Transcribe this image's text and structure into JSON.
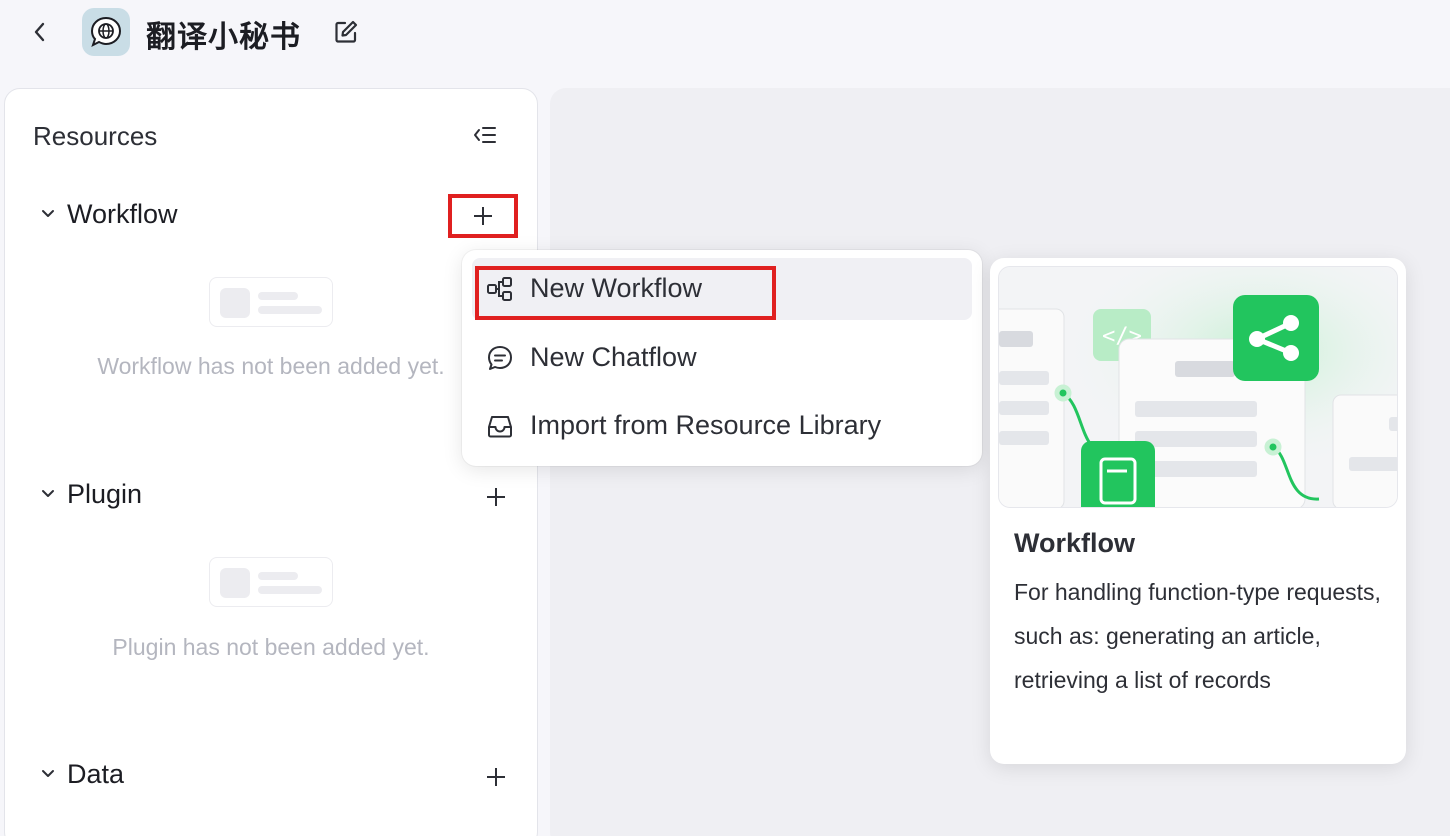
{
  "header": {
    "app_title": "翻译小秘书",
    "back_icon": "chevron-left-icon",
    "edit_icon": "edit-icon",
    "avatar_icon": "globe-chat-icon"
  },
  "sidebar": {
    "title": "Resources",
    "collapse_icon": "collapse-list-icon",
    "sections": [
      {
        "label": "Workflow",
        "empty_text": "Workflow has not been added yet."
      },
      {
        "label": "Plugin",
        "empty_text": "Plugin has not been added yet."
      },
      {
        "label": "Data"
      }
    ]
  },
  "dropdown": {
    "items": [
      {
        "label": "New Workflow",
        "icon": "workflow-icon"
      },
      {
        "label": "New Chatflow",
        "icon": "chat-icon"
      },
      {
        "label": "Import from Resource Library",
        "icon": "inbox-icon"
      }
    ]
  },
  "preview": {
    "title": "Workflow",
    "description": "For handling function-type requests, such as: generating an article, retrieving a list of records"
  },
  "colors": {
    "accent_green": "#22c55e",
    "highlight_red": "#e02020"
  }
}
